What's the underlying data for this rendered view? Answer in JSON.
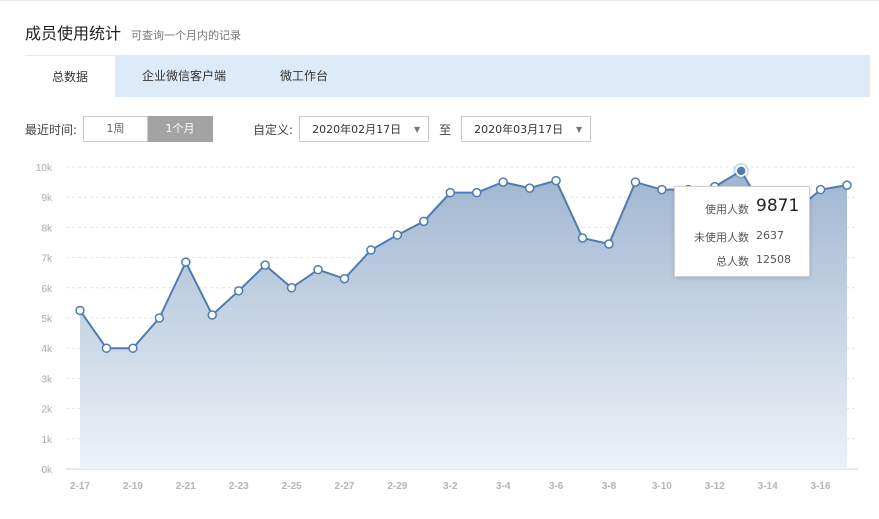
{
  "header": {
    "title": "成员使用统计",
    "subtitle": "可查询一个月内的记录"
  },
  "tabs": [
    {
      "label": "总数据",
      "active": true
    },
    {
      "label": "企业微信客户端",
      "active": false
    },
    {
      "label": "微工作台",
      "active": false
    }
  ],
  "filters": {
    "recent_label": "最近时间:",
    "range_options": [
      {
        "label": "1周",
        "active": false
      },
      {
        "label": "1个月",
        "active": true
      }
    ],
    "custom_label": "自定义:",
    "start_date": "2020年02月17日",
    "separator": "至",
    "end_date": "2020年03月17日"
  },
  "tooltip": {
    "used_label": "使用人数",
    "used_value": "9871",
    "unused_label": "未使用人数",
    "unused_value": "2637",
    "total_label": "总人数",
    "total_value": "12508"
  },
  "colors": {
    "line": "#4f7cb0",
    "area_top": "#9fb6d1",
    "area_bottom": "#eef2f7",
    "tab_bar": "#ddeaf8"
  },
  "chart_data": {
    "type": "area",
    "x": [
      "2-17",
      "2-18",
      "2-19",
      "2-20",
      "2-21",
      "2-22",
      "2-23",
      "2-24",
      "2-25",
      "2-26",
      "2-27",
      "2-28",
      "2-29",
      "3-1",
      "3-2",
      "3-3",
      "3-4",
      "3-5",
      "3-6",
      "3-7",
      "3-8",
      "3-9",
      "3-10",
      "3-11",
      "3-12",
      "3-13",
      "3-14",
      "3-15",
      "3-16",
      "3-17"
    ],
    "x_tick_labels": [
      "2-17",
      "2-19",
      "2-21",
      "2-23",
      "2-25",
      "2-27",
      "2-29",
      "3-2",
      "3-4",
      "3-6",
      "3-8",
      "3-10",
      "3-12",
      "3-14",
      "3-16"
    ],
    "y_tick_labels": [
      "0k",
      "1k",
      "2k",
      "3k",
      "4k",
      "5k",
      "6k",
      "7k",
      "8k",
      "9k",
      "10k"
    ],
    "values": [
      5250,
      4000,
      4000,
      5000,
      6850,
      5100,
      5900,
      6750,
      6000,
      6600,
      6300,
      7250,
      7750,
      8200,
      9150,
      9150,
      9500,
      9300,
      9550,
      7650,
      7450,
      9500,
      9250,
      9250,
      9350,
      9871,
      8350,
      8500,
      9250,
      9400
    ],
    "highlight_index": 25,
    "ylim": [
      0,
      10000
    ],
    "grid": true,
    "legend": "none"
  }
}
